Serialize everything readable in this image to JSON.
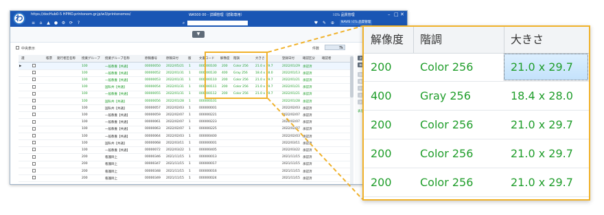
{
  "window": {
    "url": "https://docHub0-5 HPMO.printonom.gr.jp/w3/printonomos/",
    "title": "WA500 00 - 詳細管理（読取専用）",
    "user": "ｼｽﾃﾑ 品質管理",
    "user_select": "NAVIS ｼｽﾃﾑ 品質管理",
    "logo": "わ",
    "controls": [
      "–",
      "□",
      "✕"
    ]
  },
  "toolbar": {
    "icons": [
      "menu-icon",
      "home-icon",
      "lock-icon",
      "user-icon",
      "gear-icon",
      "refresh-icon",
      "help-icon"
    ],
    "glyphs": [
      "≡",
      "⌂",
      "▲",
      "●",
      "⚙",
      "⟳",
      "?"
    ],
    "search_icon": "⌕",
    "search_placeholder": "",
    "right_glyphs": [
      "♥",
      "✎",
      "⊕"
    ]
  },
  "collapse_button": "▼",
  "filter": {
    "label": "中央表示",
    "count_label": "件数",
    "count_value": "7k"
  },
  "grid": {
    "headers": [
      "選",
      "",
      "帳票",
      "発行者区名称",
      "授業グループ",
      "授業グループ名称",
      "原稿番号",
      "原稿日付",
      "版",
      "文書コード",
      "解像度",
      "階調",
      "大きさ",
      "登録日付",
      "確認区分",
      "確認者"
    ],
    "rows": [
      {
        "marker": "▶",
        "flag": "",
        "group": "100",
        "gname": "一般教養【共通】",
        "num": "00000050",
        "date": "2022/05/21",
        "ver": "1",
        "code": "000000100",
        "res": "200",
        "tone": "Color 256",
        "size": "21.0 x 29.7",
        "reg": "2022/01/29",
        "chk": "承認済",
        "green": true
      },
      {
        "marker": "",
        "flag": "",
        "group": "100",
        "gname": "一般教養【共通】",
        "num": "00000052",
        "date": "2022/01/31",
        "ver": "1",
        "code": "000000130",
        "res": "400",
        "tone": "Gray 256",
        "size": "18.4 x 28.0",
        "reg": "2022/01/13",
        "chk": "承認済",
        "green": true
      },
      {
        "marker": "",
        "flag": "",
        "group": "100",
        "gname": "一般教養【共通】",
        "num": "00000053",
        "date": "2022/01/31",
        "ver": "1",
        "code": "000000110",
        "res": "200",
        "tone": "Color 256",
        "size": "21.0 x 29.7",
        "reg": "2022/01/21",
        "chk": "承認済",
        "green": true
      },
      {
        "marker": "",
        "flag": "",
        "group": "100",
        "gname": "国私共【共通】",
        "num": "00000054",
        "date": "2022/01/31",
        "ver": "1",
        "code": "000000111",
        "res": "200",
        "tone": "Color 256",
        "size": "21.0 x 29.7",
        "reg": "2022/01/21",
        "chk": "承認済",
        "green": true
      },
      {
        "marker": "",
        "flag": "",
        "group": "100",
        "gname": "一般教養【共通】",
        "num": "00000055",
        "date": "2022/01/31",
        "ver": "1",
        "code": "000000112",
        "res": "200",
        "tone": "Color 256",
        "size": "21.0 x 29.7",
        "reg": "2022/01/21",
        "chk": "承認済",
        "green": true
      },
      {
        "marker": "",
        "flag": "",
        "group": "100",
        "gname": "国私共【共通】",
        "num": "00000056",
        "date": "2022/01/28",
        "ver": "1",
        "code": "000000101",
        "res": "",
        "tone": "",
        "size": "",
        "reg": "2022/01/28",
        "chk": "承認済",
        "green": true
      },
      {
        "marker": "",
        "flag": "",
        "group": "100",
        "gname": "国私共【共通】",
        "num": "00000057",
        "date": "2022/02/03",
        "ver": "1",
        "code": "000000001",
        "res": "",
        "tone": "",
        "size": "",
        "reg": "2022/02/03",
        "chk": "承認済",
        "green": false
      },
      {
        "marker": "",
        "flag": "",
        "group": "100",
        "gname": "一般教養【共通】",
        "num": "00000059",
        "date": "2022/02/07",
        "ver": "1",
        "code": "000000221",
        "res": "",
        "tone": "",
        "size": "",
        "reg": "2022/02/07",
        "chk": "承認済",
        "green": false
      },
      {
        "marker": "",
        "flag": "",
        "group": "100",
        "gname": "一般教養【共通】",
        "num": "00000061",
        "date": "2022/02/07",
        "ver": "1",
        "code": "000000223",
        "res": "",
        "tone": "",
        "size": "",
        "reg": "2022/02/07",
        "chk": "承認済",
        "green": false
      },
      {
        "marker": "",
        "flag": "",
        "group": "100",
        "gname": "一般教養【共通】",
        "num": "00000063",
        "date": "2022/02/07",
        "ver": "1",
        "code": "000000225",
        "res": "",
        "tone": "",
        "size": "",
        "reg": "2022/02/07",
        "chk": "承認済",
        "green": false
      },
      {
        "marker": "",
        "flag": "",
        "group": "100",
        "gname": "一般教養【共通】",
        "num": "00000064",
        "date": "2022/02/03",
        "ver": "1",
        "code": "000000400",
        "res": "",
        "tone": "",
        "size": "",
        "reg": "2022/02/03",
        "chk": "承認済",
        "green": false
      },
      {
        "marker": "",
        "flag": "",
        "group": "100",
        "gname": "国私共【共通】",
        "num": "00000068",
        "date": "2022/03/11",
        "ver": "1",
        "code": "000000001",
        "res": "",
        "tone": "",
        "size": "",
        "reg": "2022/03/11",
        "chk": "承認済",
        "green": false
      },
      {
        "marker": "",
        "flag": "",
        "group": "100",
        "gname": "一般教養【共通】",
        "num": "00000072",
        "date": "2022/03/22",
        "ver": "1",
        "code": "000000405",
        "res": "",
        "tone": "",
        "size": "",
        "reg": "2022/03/22",
        "chk": "承認済",
        "green": false
      },
      {
        "marker": "",
        "flag": "",
        "group": "200",
        "gname": "看護師上",
        "num": "00000346",
        "date": "2021/11/15",
        "ver": "1",
        "code": "000000013",
        "res": "",
        "tone": "",
        "size": "",
        "reg": "2021/11/15",
        "chk": "承認済",
        "green": false
      },
      {
        "marker": "",
        "flag": "",
        "group": "200",
        "gname": "看護師上",
        "num": "00000347",
        "date": "2021/11/15",
        "ver": "1",
        "code": "000000017",
        "res": "",
        "tone": "",
        "size": "",
        "reg": "2021/11/15",
        "chk": "承認済",
        "green": false
      },
      {
        "marker": "",
        "flag": "",
        "group": "200",
        "gname": "看護師上",
        "num": "00000348",
        "date": "2021/11/15",
        "ver": "1",
        "code": "000000016",
        "res": "",
        "tone": "",
        "size": "",
        "reg": "2021/11/15",
        "chk": "承認済",
        "green": false
      },
      {
        "marker": "",
        "flag": "",
        "group": "200",
        "gname": "看護師上",
        "num": "00000349",
        "date": "2021/11/15",
        "ver": "1",
        "code": "000000024",
        "res": "",
        "tone": "",
        "size": "",
        "reg": "2021/11/15",
        "chk": "承認済",
        "green": false
      }
    ]
  },
  "side_panel": {
    "buttons": [
      "追加",
      "編集",
      "削除",
      "複製",
      "印刷",
      "出力",
      "戻る"
    ],
    "link": "表示順"
  },
  "zoom": {
    "headers": [
      "解像度",
      "階調",
      "大きさ"
    ],
    "rows": [
      [
        "200",
        "Color 256",
        "21.0 x 29.7"
      ],
      [
        "400",
        "Gray 256",
        "18.4 x 28.0"
      ],
      [
        "200",
        "Color 256",
        "21.0 x 29.7"
      ],
      [
        "200",
        "Color 256",
        "21.0 x 29.7"
      ],
      [
        "200",
        "Color 256",
        "21.0 x 29.7"
      ]
    ]
  },
  "colors": {
    "accent": "#1a56b4",
    "highlight": "#f0b129",
    "value_green": "#1f9d2a"
  }
}
